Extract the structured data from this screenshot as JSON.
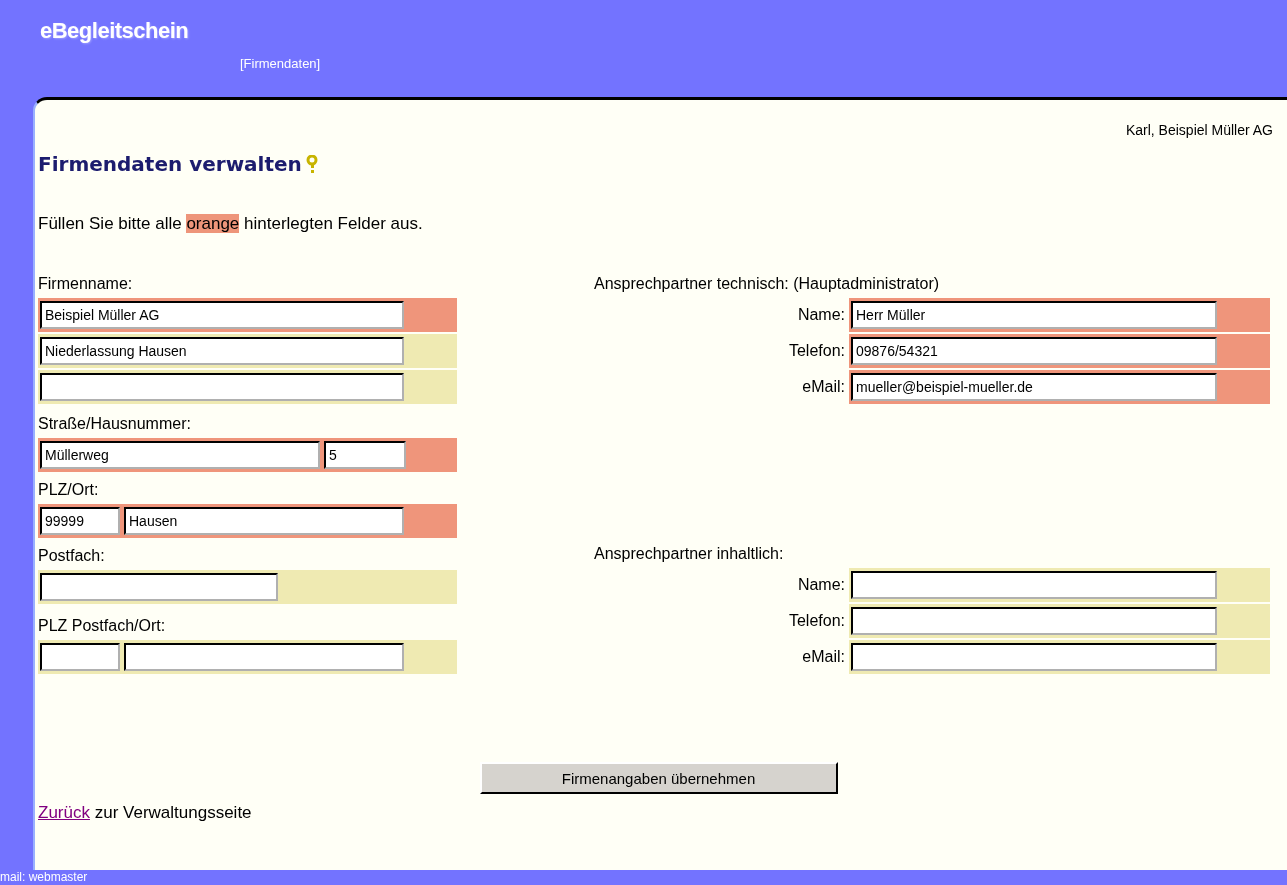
{
  "header": {
    "logo": "eBegleitschein",
    "section": "[Firmendaten]"
  },
  "user": "Karl, Beispiel Müller AG",
  "heading": "Firmendaten verwalten",
  "instruction": {
    "before": "Füllen Sie bitte alle",
    "highlight": "orange",
    "after": "hinterlegten Felder aus."
  },
  "left_sections": [
    {
      "label": "Firmenname:",
      "rows": [
        {
          "required": true,
          "fields": [
            {
              "kind": "wide",
              "value": "Beispiel Müller AG"
            }
          ]
        },
        {
          "required": false,
          "fields": [
            {
              "kind": "wide",
              "value": "Niederlassung Hausen"
            }
          ]
        },
        {
          "required": false,
          "fields": [
            {
              "kind": "wide"
            }
          ]
        }
      ]
    },
    {
      "label": "Straße/Hausnummer:",
      "rows": [
        {
          "required": true,
          "fields": [
            {
              "kind": "street",
              "value": "Müllerweg"
            },
            {
              "kind": "number",
              "value": "5"
            }
          ]
        }
      ]
    },
    {
      "label": "PLZ/Ort:",
      "rows": [
        {
          "required": true,
          "fields": [
            {
              "kind": "zip",
              "value": "99999"
            },
            {
              "kind": "city",
              "value": "Hausen"
            }
          ]
        }
      ]
    },
    {
      "label": "Postfach:",
      "rows": [
        {
          "required": false,
          "fields": [
            {
              "kind": "medium"
            }
          ]
        }
      ]
    },
    {
      "label": "PLZ Postfach/Ort:",
      "rows": [
        {
          "required": false,
          "fields": [
            {
              "kind": "zip"
            },
            {
              "kind": "city"
            }
          ]
        }
      ]
    }
  ],
  "right_sections": [
    {
      "label": "Ansprechpartner technisch: (Hauptadministrator)",
      "rows": [
        {
          "label": "Name:",
          "required": true,
          "value": "Herr Müller"
        },
        {
          "label": "Telefon:",
          "required": true,
          "value": "09876/54321"
        },
        {
          "label": "eMail:",
          "required": true,
          "value": "mueller@beispiel-mueller.de"
        }
      ]
    },
    {
      "label": "Ansprechpartner inhaltlich:",
      "rows": [
        {
          "label": "Name:",
          "required": false
        },
        {
          "label": "Telefon:",
          "required": false
        },
        {
          "label": "eMail:",
          "required": false
        }
      ]
    }
  ],
  "submit": "Firmenangaben übernehmen",
  "back": {
    "link": "Zurück",
    "text": "zur Verwaltungsseite"
  },
  "footer": "mail: webmaster"
}
